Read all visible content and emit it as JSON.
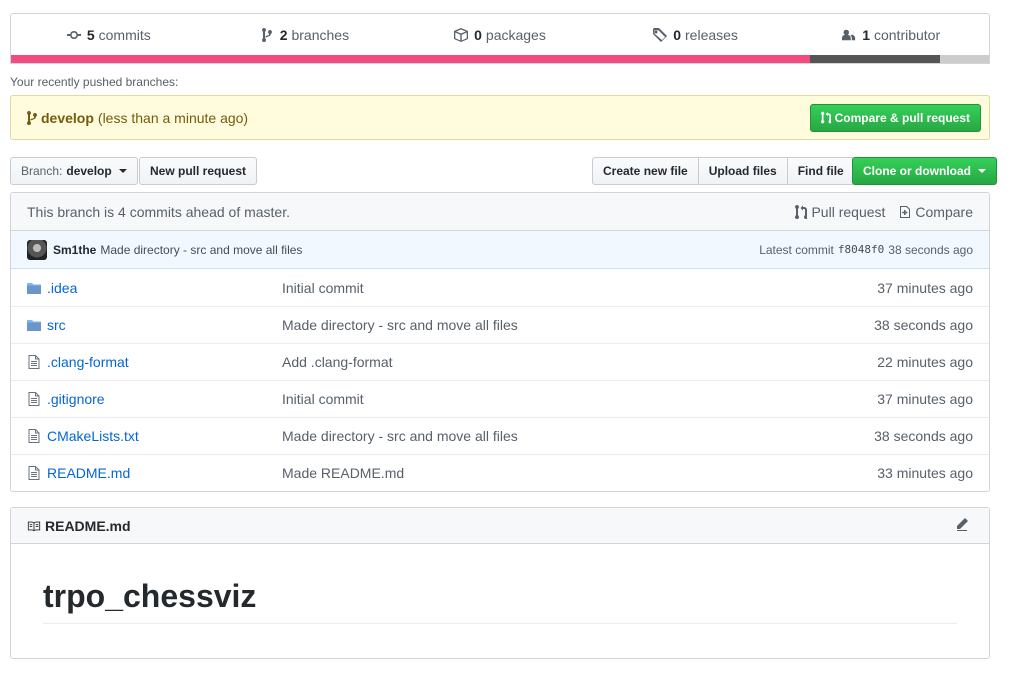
{
  "summary": {
    "items": [
      {
        "icon": "commit-icon",
        "count": "5",
        "label": "commits"
      },
      {
        "icon": "branch-icon",
        "count": "2",
        "label": "branches"
      },
      {
        "icon": "package-icon",
        "count": "0",
        "label": "packages"
      },
      {
        "icon": "tag-icon",
        "count": "0",
        "label": "releases"
      },
      {
        "icon": "people-icon",
        "count": "1",
        "label": "contributor"
      }
    ],
    "language_bar": [
      {
        "percent": 81.7,
        "color": "#f34b7d"
      },
      {
        "percent": 13.3,
        "color": "#555555"
      },
      {
        "percent": 5.0,
        "color": "#cccccc"
      }
    ]
  },
  "recent": {
    "label": "Your recently pushed branches:",
    "branch": "develop",
    "time": "(less than a minute ago)",
    "compare_button": "Compare & pull request"
  },
  "toolbar": {
    "branch_label": "Branch:",
    "branch_value": "develop",
    "new_pr": "New pull request",
    "create_file": "Create new file",
    "upload_files": "Upload files",
    "find_file": "Find file",
    "clone": "Clone or download"
  },
  "branch_info": {
    "text": "This branch is 4 commits ahead of master.",
    "pull_request": "Pull request",
    "compare": "Compare"
  },
  "latest_commit": {
    "author": "Sm1the",
    "message": "Made directory - src and move all files",
    "label": "Latest commit",
    "sha": "f8048f0",
    "time": "38 seconds ago"
  },
  "files": [
    {
      "type": "folder",
      "name": ".idea",
      "message": "Initial commit",
      "age": "37 minutes ago"
    },
    {
      "type": "folder",
      "name": "src",
      "message": "Made directory - src and move all files",
      "age": "38 seconds ago"
    },
    {
      "type": "file",
      "name": ".clang-format",
      "message": "Add .clang-format",
      "age": "22 minutes ago"
    },
    {
      "type": "file",
      "name": ".gitignore",
      "message": "Initial commit",
      "age": "37 minutes ago"
    },
    {
      "type": "file",
      "name": "CMakeLists.txt",
      "message": "Made directory - src and move all files",
      "age": "38 seconds ago"
    },
    {
      "type": "file",
      "name": "README.md",
      "message": "Made README.md",
      "age": "33 minutes ago"
    }
  ],
  "readme": {
    "filename": "README.md",
    "heading": "trpo_chessviz"
  }
}
